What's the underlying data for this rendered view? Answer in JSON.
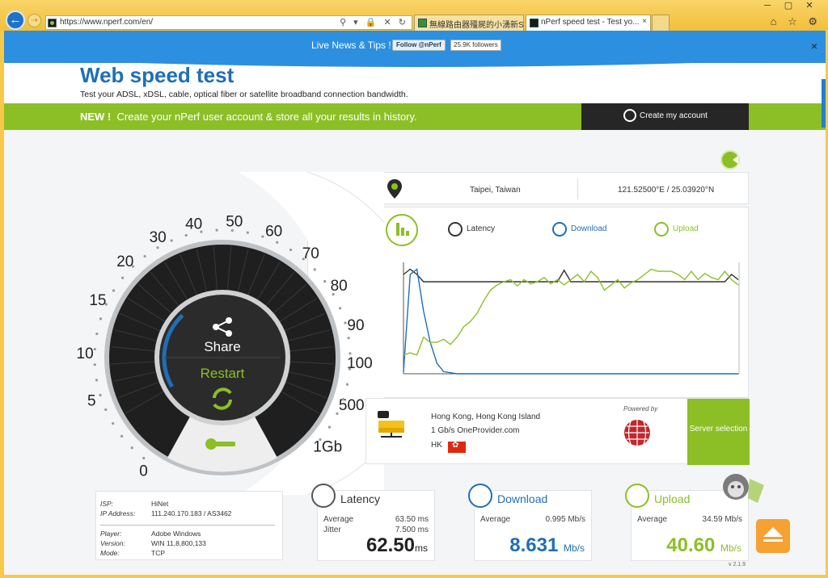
{
  "browser": {
    "url": "https://www.nperf.com/en/",
    "tabs": [
      {
        "label": "無線路由器殭屍的小湧新Synol..."
      },
      {
        "label": "nPerf speed test - Test yo..."
      }
    ],
    "tab_close": "×",
    "window_buttons": [
      "─",
      "▢",
      "✕"
    ],
    "nav_icons": "⌂ ☆ ⚙",
    "address_icons": "⚲ ▾ 🔒 ✕ ↻",
    "back_symbol": "←",
    "forward_symbol": "⇢"
  },
  "news": {
    "text": "Live News & Tips !",
    "follow_label": "Follow @nPerf",
    "followers": "25.9K followers",
    "close": "×"
  },
  "header": {
    "title": "Web speed test",
    "subtitle": "Test your ADSL, xDSL, cable, optical fiber or satellite broadband connection bandwidth."
  },
  "promo": {
    "new_label": "NEW !",
    "text": "Create your nPerf user account & store all your results in history.",
    "button_label": "Create my account"
  },
  "gauge": {
    "scale": [
      "0",
      "5",
      "10",
      "15",
      "20",
      "30",
      "40",
      "50",
      "60",
      "70",
      "80",
      "90",
      "100",
      "500",
      "1Gb"
    ],
    "share_label": "Share",
    "restart_label": "Restart",
    "progress": 0.08
  },
  "location": {
    "name": "Taipei, Taiwan",
    "coords": "121.52500°E / 25.03920°N"
  },
  "graph": {
    "legend": {
      "latency": "Latency",
      "download": "Download",
      "upload": "Upload"
    }
  },
  "chart_data": {
    "type": "line",
    "x": [
      0,
      2,
      4,
      6,
      8,
      10,
      12,
      14,
      16,
      18,
      20,
      22,
      24,
      26,
      28,
      30,
      32,
      34,
      36,
      38,
      40,
      42,
      44,
      46,
      48,
      50,
      52,
      54,
      56,
      58,
      60,
      62,
      64,
      66,
      68,
      70,
      72,
      74,
      76,
      78,
      80,
      82,
      84,
      86,
      88,
      90,
      92,
      94,
      96,
      98,
      100
    ],
    "series": [
      {
        "name": "Latency",
        "color": "#333333",
        "values": [
          0.95,
          1.0,
          0.95,
          0.88,
          0.88,
          0.88,
          0.88,
          0.88,
          0.88,
          0.88,
          0.88,
          0.88,
          0.88,
          0.88,
          0.88,
          0.88,
          0.88,
          0.88,
          0.88,
          0.88,
          0.88,
          0.88,
          0.88,
          0.88,
          0.99,
          0.88,
          0.88,
          0.88,
          0.88,
          0.88,
          0.88,
          0.88,
          0.88,
          0.88,
          0.88,
          0.88,
          0.88,
          0.88,
          0.88,
          0.88,
          0.88,
          0.88,
          0.88,
          0.88,
          0.88,
          0.88,
          0.88,
          0.88,
          0.88,
          0.95,
          0.9
        ]
      },
      {
        "name": "Download",
        "color": "#1e6fb6",
        "values": [
          0.02,
          0.95,
          1.0,
          0.6,
          0.3,
          0.1,
          0.02,
          0.01,
          0.0,
          0.0,
          0.0,
          0.0,
          0.0,
          0.0,
          0.0,
          0.0,
          0.0,
          0.0,
          0.0,
          0.0,
          0.0,
          0.0,
          0.0,
          0.0,
          0.0,
          0.0,
          0.0,
          0.0,
          0.0,
          0.0,
          0.0,
          0.0,
          0.0,
          0.0,
          0.0,
          0.0,
          0.0,
          0.0,
          0.0,
          0.0,
          0.0,
          0.0,
          0.0,
          0.0,
          0.0,
          0.0,
          0.0,
          0.0,
          0.0,
          0.0,
          0.0
        ]
      },
      {
        "name": "Upload",
        "color": "#8cbf26",
        "values": [
          0.18,
          0.2,
          0.18,
          0.35,
          0.3,
          0.3,
          0.33,
          0.28,
          0.35,
          0.45,
          0.5,
          0.58,
          0.7,
          0.8,
          0.85,
          0.88,
          0.9,
          0.84,
          0.9,
          0.86,
          0.88,
          0.92,
          0.86,
          0.9,
          0.85,
          0.9,
          0.95,
          0.88,
          0.98,
          0.92,
          0.8,
          0.85,
          0.9,
          0.82,
          0.87,
          0.9,
          0.95,
          1.0,
          0.98,
          0.98,
          0.98,
          0.95,
          0.9,
          0.98,
          0.9,
          0.96,
          0.92,
          0.9,
          0.98,
          0.9,
          0.85
        ]
      }
    ],
    "ylim": [
      0,
      1.05
    ],
    "grid": false,
    "legend": "top"
  },
  "server": {
    "city": "Hong Kong, Hong Kong Island",
    "provider": "1 Gb/s OneProvider.com",
    "country": "HK",
    "powered_by": "Powered by",
    "selection_label": "Server selection"
  },
  "isp": {
    "rows": [
      {
        "k": "ISP:",
        "v": "HiNet"
      },
      {
        "k": "IP Address:",
        "v": "111.240.170.183 / AS3462"
      },
      {
        "k": "Player:",
        "v": "Adobe Windows"
      },
      {
        "k": "Version:",
        "v": "WIN 11,8,800,133"
      },
      {
        "k": "Mode:",
        "v": "TCP"
      }
    ]
  },
  "metrics": {
    "latency": {
      "title": "Latency",
      "avg_label": "Average",
      "avg": "63.50 ms",
      "jitter_label": "Jitter",
      "jitter": "7.500 ms",
      "big": "62.50",
      "unit": "ms"
    },
    "download": {
      "title": "Download",
      "avg_label": "Average",
      "avg": "0.995 Mb/s",
      "big": "8.631",
      "unit": "Mb/s"
    },
    "upload": {
      "title": "Upload",
      "avg_label": "Average",
      "avg": "34.59 Mb/s",
      "big": "40.60",
      "unit": "Mb/s"
    }
  },
  "version": "v 2.1.9",
  "colors": {
    "blue": "#1e6fb6",
    "green": "#8cbf26",
    "dark": "#262626",
    "news": "#2c8fe0"
  }
}
